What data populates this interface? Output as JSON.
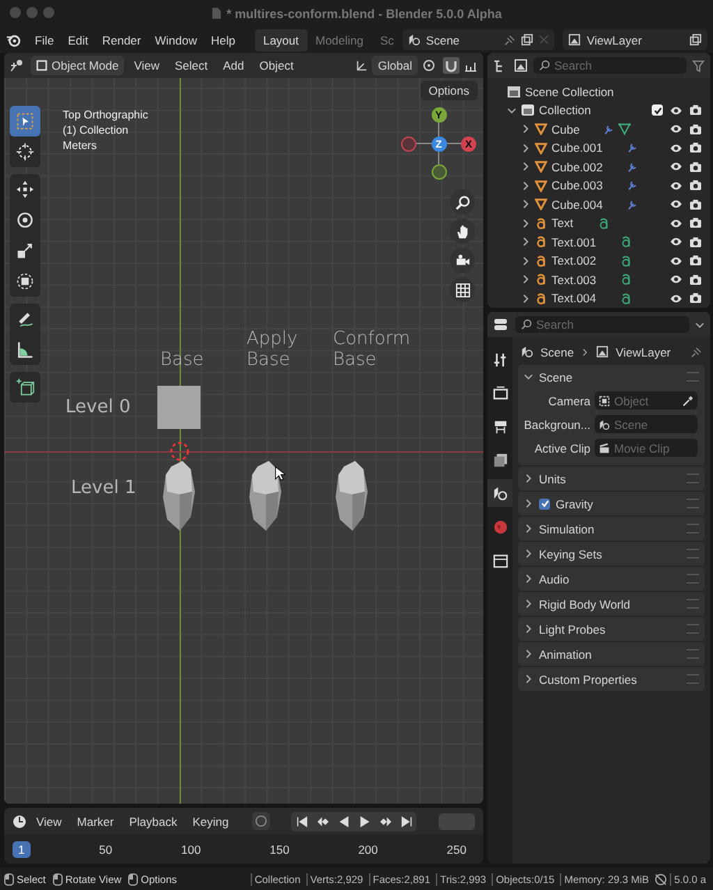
{
  "window": {
    "title": "* multires-conform.blend - Blender 5.0.0 Alpha"
  },
  "menu": [
    "File",
    "Edit",
    "Render",
    "Window",
    "Help"
  ],
  "workspaces": [
    {
      "label": "Layout",
      "selected": true
    },
    {
      "label": "Modeling",
      "selected": false
    },
    {
      "label": "Sc",
      "selected": false
    }
  ],
  "scene_selector": {
    "value": "Scene"
  },
  "view_layer_selector": {
    "value": "ViewLayer"
  },
  "viewport": {
    "mode": "Object Mode",
    "menus": [
      "View",
      "Select",
      "Add",
      "Object"
    ],
    "orientation": "Global",
    "options": "Options",
    "overlay_lines": [
      "Top Orthographic",
      "(1) Collection",
      "Meters"
    ],
    "gizmo_axes": {
      "y": "Y",
      "z": "Z",
      "x": "X"
    },
    "tool_groups": [
      [
        {
          "kind": "select",
          "selected": true
        },
        {
          "kind": "cursor",
          "selected": false
        }
      ],
      [
        {
          "kind": "move",
          "selected": false
        },
        {
          "kind": "rotate",
          "selected": false
        },
        {
          "kind": "scale",
          "selected": false
        },
        {
          "kind": "transform",
          "selected": false
        }
      ],
      [
        {
          "kind": "annotate",
          "selected": false
        },
        {
          "kind": "measure",
          "selected": false
        }
      ],
      [
        {
          "kind": "add-cube",
          "selected": false
        }
      ]
    ],
    "column_labels": [
      [
        "Base"
      ],
      [
        "Apply",
        "Base"
      ],
      [
        "Conform",
        "Base"
      ]
    ],
    "row_labels": [
      "Level 0",
      "Level 1"
    ]
  },
  "timeline": {
    "menus": [
      "View",
      "Marker"
    ],
    "dropdowns": [
      "Playback",
      "Keying"
    ],
    "current_frame": "1",
    "ticks": [
      "50",
      "100",
      "150",
      "200",
      "250"
    ]
  },
  "outliner": {
    "search": {
      "placeholder": "Search"
    },
    "tree": [
      {
        "name": "Scene Collection",
        "kind": "scene-collection",
        "children": [
          {
            "name": "Collection",
            "kind": "collection",
            "expanded": true,
            "checked": true,
            "children": [
              {
                "name": "Cube",
                "kind": "mesh",
                "expanded": false,
                "show_data": true
              },
              {
                "name": "Cube.001",
                "kind": "mesh",
                "expanded": false,
                "show_data": false
              },
              {
                "name": "Cube.002",
                "kind": "mesh",
                "expanded": false,
                "show_data": false
              },
              {
                "name": "Cube.003",
                "kind": "mesh",
                "expanded": false,
                "show_data": false
              },
              {
                "name": "Cube.004",
                "kind": "mesh",
                "expanded": false,
                "show_data": false
              },
              {
                "name": "Text",
                "kind": "text",
                "expanded": false
              },
              {
                "name": "Text.001",
                "kind": "text",
                "expanded": false
              },
              {
                "name": "Text.002",
                "kind": "text",
                "expanded": false
              },
              {
                "name": "Text.003",
                "kind": "text",
                "expanded": false
              },
              {
                "name": "Text.004",
                "kind": "text",
                "expanded": false
              }
            ]
          }
        ]
      }
    ]
  },
  "properties": {
    "search": {
      "placeholder": "Search"
    },
    "tabs": [
      {
        "kind": "tool",
        "selected": false
      },
      {
        "kind": "render",
        "selected": false
      },
      {
        "kind": "output",
        "selected": false
      },
      {
        "kind": "view-layer",
        "selected": false
      },
      {
        "kind": "scene",
        "selected": true
      },
      {
        "kind": "world",
        "selected": false
      },
      {
        "kind": "collection",
        "selected": false
      }
    ],
    "breadcrumb": [
      "Scene",
      "ViewLayer"
    ],
    "scene_panel": {
      "title": "Scene",
      "expanded": true,
      "fields": [
        {
          "label": "Camera",
          "placeholder": "Object",
          "kind": "object"
        },
        {
          "label": "Backgroun...",
          "placeholder": "Scene",
          "kind": "scene"
        },
        {
          "label": "Active Clip",
          "placeholder": "Movie Clip",
          "kind": "clip"
        }
      ]
    },
    "panels": [
      {
        "title": "Units",
        "expanded": false
      },
      {
        "title": "Gravity",
        "expanded": false,
        "checked": true
      },
      {
        "title": "Simulation",
        "expanded": false
      },
      {
        "title": "Keying Sets",
        "expanded": false
      },
      {
        "title": "Audio",
        "expanded": false
      },
      {
        "title": "Rigid Body World",
        "expanded": false
      },
      {
        "title": "Light Probes",
        "expanded": false
      },
      {
        "title": "Animation",
        "expanded": false
      },
      {
        "title": "Custom Properties",
        "expanded": false
      }
    ]
  },
  "status_bar": {
    "hints": [
      "Select",
      "Rotate View",
      "Options"
    ],
    "stats": [
      "Collection",
      "Verts:2,929",
      "Faces:2,891",
      "Tris:2,993",
      "Objects:0/15",
      "Memory: 29.3 MiB"
    ],
    "version": "5.0.0 a"
  }
}
